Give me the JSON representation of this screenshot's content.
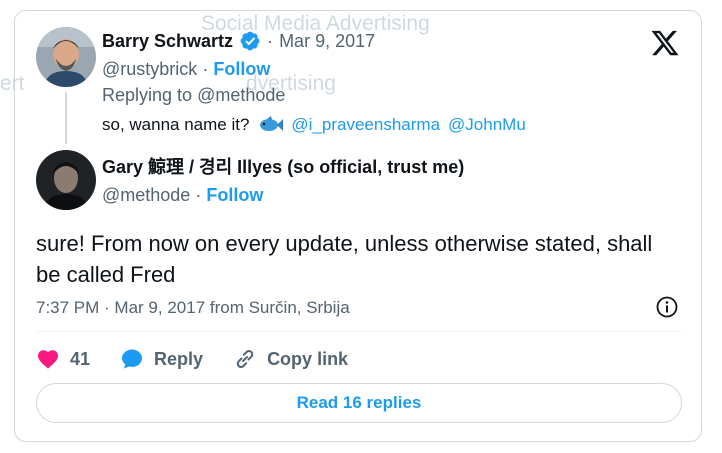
{
  "watermark": {
    "text1": "Social Media Advertising",
    "text2": "dvertising",
    "text3": "ert"
  },
  "colors": {
    "accent": "#1d9bf0",
    "muted": "#536471",
    "like": "#f91880",
    "border": "#cfd9de"
  },
  "reply_tweet": {
    "author_name": "Barry Schwartz",
    "separator": "·",
    "date": "Mar 9, 2017",
    "handle": "@rustybrick",
    "follow_label": "Follow",
    "replying_prefix": "Replying to",
    "replying_to": "@methode",
    "text": "so, wanna name it?",
    "emoji_icon": "fish-icon",
    "mention1": "@i_praveensharma",
    "mention2": "@JohnMu"
  },
  "main_tweet": {
    "author_name": "Gary 鯨理 / 경리 Illyes (so official, trust me)",
    "handle": "@methode",
    "separator": "·",
    "follow_label": "Follow",
    "text": "sure! From now on every update, unless otherwise stated, shall be called Fred",
    "timestamp": "7:37 PM · Mar 9, 2017 from Surčin, Srbija"
  },
  "actions": {
    "like_count": "41",
    "reply_label": "Reply",
    "copy_link_label": "Copy link"
  },
  "read_replies_label": "Read 16 replies"
}
